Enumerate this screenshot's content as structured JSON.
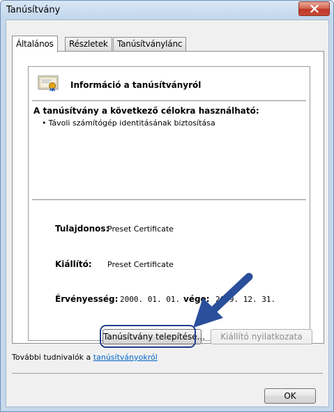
{
  "window": {
    "title": "Tanúsítvány"
  },
  "tabs": [
    {
      "label": "Általános"
    },
    {
      "label": "Részletek"
    },
    {
      "label": "Tanúsítványlánc"
    }
  ],
  "info": {
    "title": "Információ a tanúsítványról",
    "purpose_heading": "A tanúsítvány a következő célokra használható:",
    "purposes": [
      "Távoli számítógép identitásának biztosítása"
    ],
    "owner_label": "Tulajdonos:",
    "owner_value": "Preset Certificate",
    "issuer_label": "Kiállító:",
    "issuer_value": "Preset Certificate",
    "validity_label": "Érvényesség:",
    "valid_from": "2000. 01. 01.",
    "valid_to_label": "vége:",
    "valid_to": "2049. 12. 31."
  },
  "buttons": {
    "install": "Tanúsítvány telepítése...",
    "issuer_statement": "Kiállító nyilatkozata",
    "ok": "OK"
  },
  "more_info": {
    "prefix": "További tudnivalók a ",
    "link": "tanúsítványokról"
  },
  "colors": {
    "annotation_arrow": "#2a4f9b",
    "link": "#0066cc"
  }
}
